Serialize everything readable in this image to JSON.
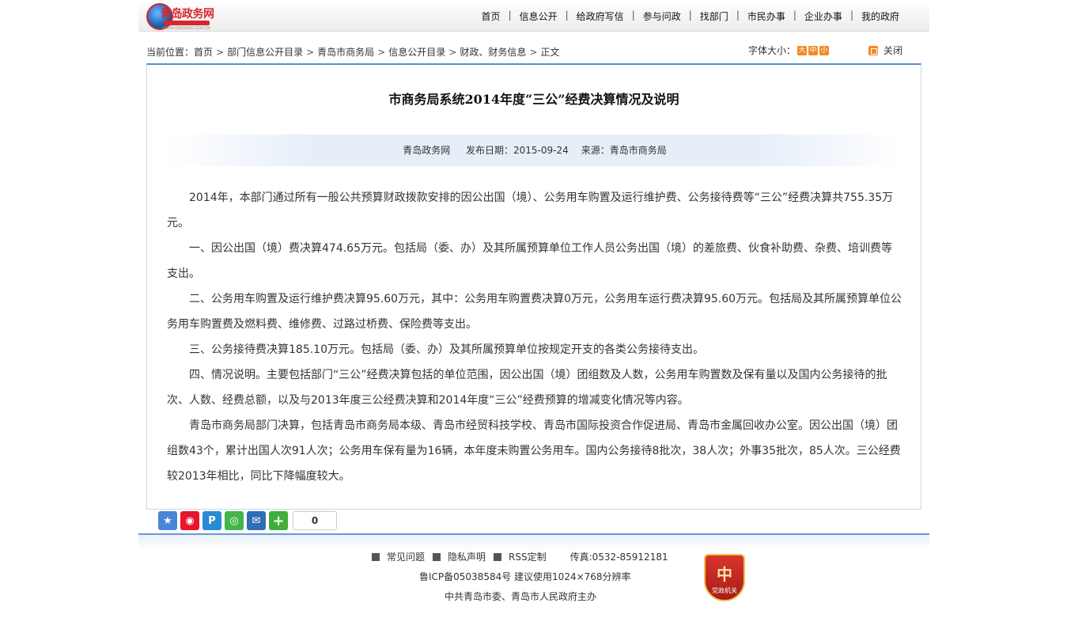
{
  "header": {
    "logo_text": "青岛政务网",
    "logo_url": "WWW.QINGDAO.GOV.CN",
    "nav": [
      "首页",
      "信息公开",
      "给政府写信",
      "参与问政",
      "找部门",
      "市民办事",
      "企业办事",
      "我的政府"
    ]
  },
  "breadcrumb": {
    "prefix": "当前位置：",
    "items": [
      "首页",
      "部门信息公开目录",
      "青岛市商务局",
      "信息公开目录",
      "财政、财务信息",
      "正文"
    ]
  },
  "tools": {
    "font_size_label": "字体大小：",
    "font_large": "大",
    "font_medium": "中",
    "font_small": "小",
    "close_label": "关闭"
  },
  "article": {
    "title": "市商务局系统2014年度“三公”经费决算情况及说明",
    "site": "青岛政务网",
    "publish": "发布日期：2015-09-24",
    "source": "来源：青岛市商务局",
    "paragraphs": [
      "2014年，本部门通过所有一般公共预算财政拨款安排的因公出国（境）、公务用车购置及运行维护费、公务接待费等“三公”经费决算共755.35万元。",
      "一、因公出国（境）费决算474.65万元。包括局（委、办）及其所属预算单位工作人员公务出国（境）的差旅费、伙食补助费、杂费、培训费等支出。",
      "二、公务用车购置及运行维护费决算95.60万元，其中：公务用车购置费决算0万元，公务用车运行费决算95.60万元。包括局及其所属预算单位公务用车购置费及燃料费、维修费、过路过桥费、保险费等支出。",
      "三、公务接待费决算185.10万元。包括局（委、办）及其所属预算单位按规定开支的各类公务接待支出。",
      "四、情况说明。主要包括部门“三公”经费决算包括的单位范围，因公出国（境）团组数及人数，公务用车购置数及保有量以及国内公务接待的批次、人数、经费总额，以及与2013年度三公经费决算和2014年度“三公”经费预算的增减变化情况等内容。",
      "青岛市商务局部门决算，包括青岛市商务局本级、青岛市经贸科技学校、青岛市国际投资合作促进局、青岛市金属回收办公室。因公出国（境）团组数43个，累计出国人次91人次；公务用车保有量为16辆，本年度未购置公务用车。国内公务接待8批次，38人次；外事35批次，85人次。三公经费较2013年相比，同比下降幅度较大。"
    ]
  },
  "share": {
    "count": "0"
  },
  "footer": {
    "links": [
      "常见问题",
      "隐私声明",
      "RSS定制"
    ],
    "fax": "传真:0532-85912181",
    "icp": "鲁ICP备05038584号  建议使用1024×768分辨率",
    "host": "中共青岛市委、青岛市人民政府主办",
    "badge_emblem": "中",
    "badge_text": "党政机关"
  }
}
